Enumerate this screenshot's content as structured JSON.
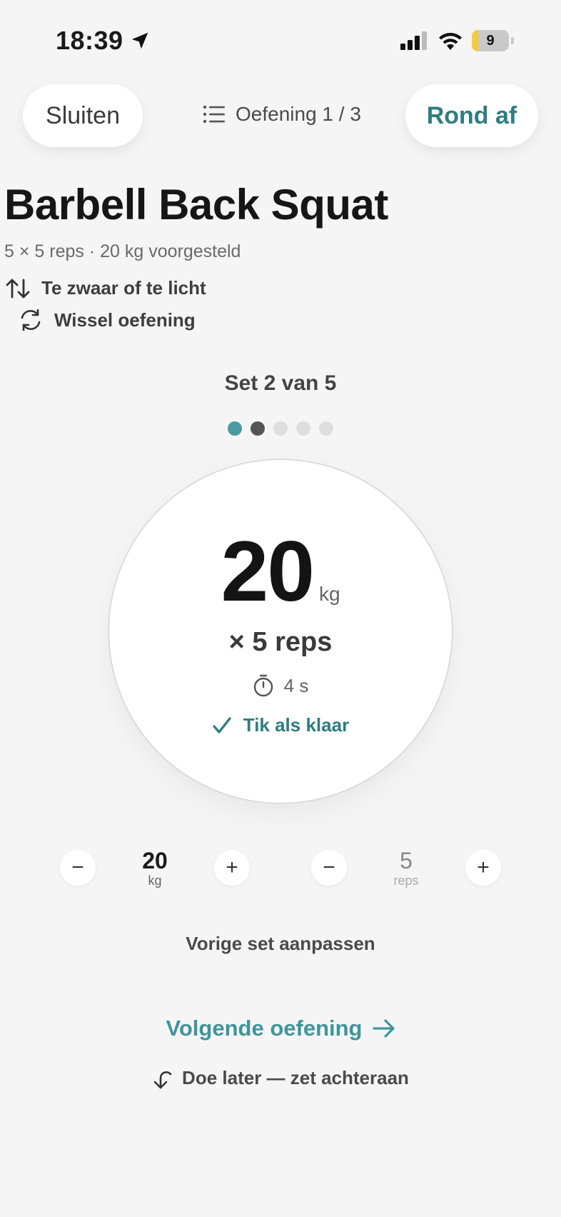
{
  "status_bar": {
    "time": "18:39",
    "battery": "9"
  },
  "nav": {
    "close_label": "Sluiten",
    "exercise_counter": "Oefening 1 / 3",
    "finish_label": "Rond af"
  },
  "exercise": {
    "title": "Barbell Back Squat",
    "subtitle": "5 × 5 reps · 20 kg voorgesteld",
    "too_heavy_label": "Te zwaar of te licht",
    "swap_label": "Wissel oefening"
  },
  "set": {
    "label": "Set 2 van 5",
    "weight": "20",
    "weight_unit": "kg",
    "reps_line": "× 5 reps",
    "timer": "4 s",
    "done_label": "Tik als klaar"
  },
  "steppers": {
    "weight": {
      "value": "20",
      "unit": "kg",
      "minus": "−",
      "plus": "+"
    },
    "reps": {
      "value": "5",
      "unit": "reps",
      "minus": "−",
      "plus": "+"
    }
  },
  "actions": {
    "adjust_previous": "Vorige set aanpassen",
    "next_exercise": "Volgende oefening",
    "do_later": "Doe later — zet achteraan"
  },
  "colors": {
    "accent": "#2f7d80",
    "accent_light": "#4a9aa0",
    "background": "#f5f5f5"
  }
}
